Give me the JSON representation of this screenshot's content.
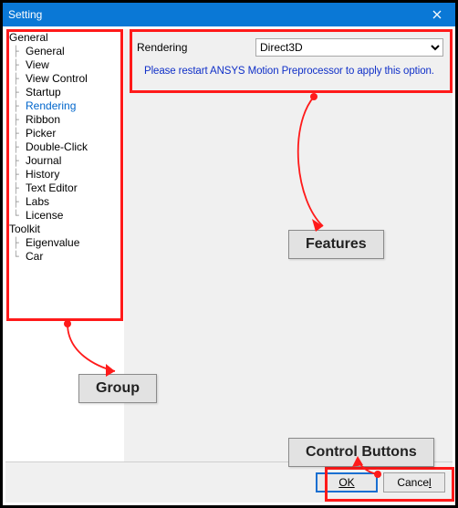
{
  "window": {
    "title": "Setting"
  },
  "tree": {
    "roots": [
      {
        "label": "General",
        "children": [
          "General",
          "View",
          "View Control",
          "Startup",
          "Rendering",
          "Ribbon",
          "Picker",
          "Double-Click",
          "Journal",
          "History",
          "Text Editor",
          "Labs",
          "License"
        ]
      },
      {
        "label": "Toolkit",
        "children": [
          "Eigenvalue",
          "Car"
        ]
      }
    ],
    "selected": "Rendering"
  },
  "features": {
    "label": "Rendering",
    "dropdown_value": "Direct3D",
    "restart_msg": "Please restart ANSYS Motion Preprocessor to apply this option."
  },
  "buttons": {
    "ok": "OK",
    "cancel": "Cancel"
  },
  "callouts": {
    "group": "Group",
    "features": "Features",
    "control_buttons": "Control Buttons"
  },
  "colors": {
    "accent": "#ff1a1a",
    "titlebar": "#0a78d6",
    "link": "#1030c8"
  }
}
